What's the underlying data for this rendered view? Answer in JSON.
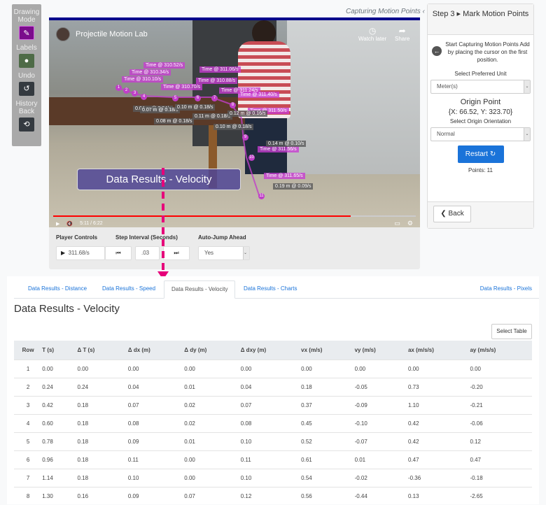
{
  "toolbar": {
    "drawing_mode": "Drawing Mode",
    "labels": "Labels",
    "undo": "Undo",
    "history_back": "History Back",
    "colors": {
      "drawing": "#7b0c8c",
      "labels": "#4e6b47",
      "undo": "#343a40"
    }
  },
  "caption": "Capturing Motion Points",
  "video": {
    "title": "Projectile Motion Lab",
    "watch_later": "Watch later",
    "share": "Share",
    "time": "5:11 / 6:22",
    "progress_fraction": 0.82,
    "overlay_title": "Data Results - Velocity",
    "time_labels": [
      "Time @ 310.52/s",
      "Time @ 310.34/s",
      "Time @ 310.10/s",
      "Time @ 311.06/s",
      "Time @ 310.88/s",
      "Time @ 310.70/s",
      "Time @ 311.24/s",
      "Time @ 311.40/s",
      "Time @ 311.50/s",
      "Time @ 311.56/s",
      "Time @ 311.65/s"
    ],
    "distance_labels": [
      "0.04 m @ 0.24/s",
      "0.07 m @ 0.18/s",
      "0.08 m @ 0.18/s",
      "0.10 m @ 0.18/s",
      "0.11 m @ 0.18/s",
      "0.10 m @ 0.18/s",
      "0.12 m @ 0.16/s",
      "0.14 m @ 0.10/s",
      "0.19 m @ 0.09/s"
    ],
    "points": [
      "1",
      "2",
      "3",
      "4",
      "5",
      "6",
      "7",
      "8",
      "9",
      "10",
      "11"
    ]
  },
  "player": {
    "controls_label": "Player Controls",
    "step_label": "Step Interval (Seconds)",
    "autojump_label": "Auto-Jump Ahead",
    "current_time": "311.68/s",
    "step_value": ".03",
    "autojump_value": "Yes"
  },
  "panel": {
    "step_title": "Step 3 ▸ Mark Motion Points",
    "intro": "Start Capturing Motion Points Add by placing the cursor on the first position.",
    "unit_label": "Select Preferred Unit",
    "unit_value": "Meter(s)",
    "origin_title": "Origin Point",
    "origin_coords": "{X: 66.52, Y: 323.70}",
    "orientation_label": "Select Origin Orientation",
    "orientation_value": "Normal",
    "restart": "Restart",
    "points": "Points: 11",
    "back": "Back"
  },
  "results": {
    "tabs": [
      "Data Results - Distance",
      "Data Results - Speed",
      "Data Results - Velocity",
      "Data Results - Charts",
      "Data Results - Pixels"
    ],
    "active_tab": "Data Results - Velocity",
    "title": "Data Results - Velocity",
    "select_table": "Select Table",
    "columns": [
      "Row",
      "T (s)",
      "Δ T (s)",
      "Δ dx (m)",
      "Δ dy (m)",
      "Δ dxy (m)",
      "vx (m/s)",
      "vy (m/s)",
      "ax (m/s/s)",
      "ay (m/s/s)"
    ],
    "rows": [
      [
        "1",
        "0.00",
        "0.00",
        "0.00",
        "0.00",
        "0.00",
        "0.00",
        "0.00",
        "0.00",
        "0.00"
      ],
      [
        "2",
        "0.24",
        "0.24",
        "0.04",
        "0.01",
        "0.04",
        "0.18",
        "-0.05",
        "0.73",
        "-0.20"
      ],
      [
        "3",
        "0.42",
        "0.18",
        "0.07",
        "0.02",
        "0.07",
        "0.37",
        "-0.09",
        "1.10",
        "-0.21"
      ],
      [
        "4",
        "0.60",
        "0.18",
        "0.08",
        "0.02",
        "0.08",
        "0.45",
        "-0.10",
        "0.42",
        "-0.06"
      ],
      [
        "5",
        "0.78",
        "0.18",
        "0.09",
        "0.01",
        "0.10",
        "0.52",
        "-0.07",
        "0.42",
        "0.12"
      ],
      [
        "6",
        "0.96",
        "0.18",
        "0.11",
        "0.00",
        "0.11",
        "0.61",
        "0.01",
        "0.47",
        "0.47"
      ],
      [
        "7",
        "1.14",
        "0.18",
        "0.10",
        "0.00",
        "0.10",
        "0.54",
        "-0.02",
        "-0.36",
        "-0.18"
      ],
      [
        "8",
        "1.30",
        "0.16",
        "0.09",
        "0.07",
        "0.12",
        "0.56",
        "-0.44",
        "0.13",
        "-2.65"
      ]
    ]
  }
}
